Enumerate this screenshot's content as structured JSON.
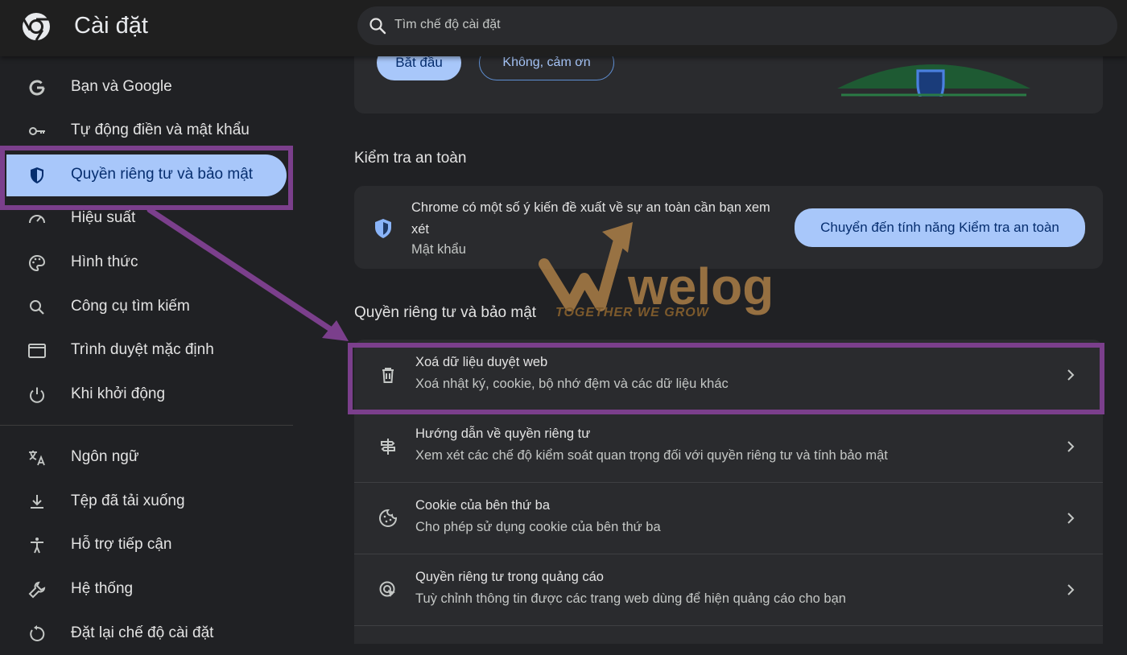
{
  "app": {
    "title": "Cài đặt"
  },
  "search": {
    "placeholder": "Tìm chế độ cài đặt"
  },
  "sidebar": {
    "items": [
      {
        "label": "Bạn và Google",
        "icon": "google-g-icon"
      },
      {
        "label": "Tự động điền và mật khẩu",
        "icon": "key-icon"
      },
      {
        "label": "Quyền riêng tư và bảo mật",
        "icon": "shield-icon",
        "active": true
      },
      {
        "label": "Hiệu suất",
        "icon": "speedometer-icon"
      },
      {
        "label": "Hình thức",
        "icon": "palette-icon"
      },
      {
        "label": "Công cụ tìm kiếm",
        "icon": "search-icon"
      },
      {
        "label": "Trình duyệt mặc định",
        "icon": "browser-window-icon"
      },
      {
        "label": "Khi khởi động",
        "icon": "power-icon"
      },
      {
        "label": "Ngôn ngữ",
        "icon": "translate-icon"
      },
      {
        "label": "Tệp đã tải xuống",
        "icon": "download-icon"
      },
      {
        "label": "Hỗ trợ tiếp cận",
        "icon": "accessibility-icon"
      },
      {
        "label": "Hệ thống",
        "icon": "wrench-icon"
      },
      {
        "label": "Đặt lại chế độ cài đặt",
        "icon": "reset-icon"
      }
    ]
  },
  "promo": {
    "start_label": "Bắt đầu",
    "decline_label": "Không, cảm ơn"
  },
  "safety_check": {
    "heading": "Kiểm tra an toàn",
    "message": "Chrome có một số ý kiến đề xuất về sự an toàn cần bạn xem xét",
    "detail": "Mật khẩu",
    "button_label": "Chuyển đến tính năng Kiểm tra an toàn"
  },
  "privacy": {
    "heading": "Quyền riêng tư và bảo mật",
    "rows": [
      {
        "title": "Xoá dữ liệu duyệt web",
        "subtitle": "Xoá nhật ký, cookie, bộ nhớ đệm và các dữ liệu khác",
        "icon": "trash-icon"
      },
      {
        "title": "Hướng dẫn về quyền riêng tư",
        "subtitle": "Xem xét các chế độ kiểm soát quan trọng đối với quyền riêng tư và tính bảo mật",
        "icon": "signpost-icon"
      },
      {
        "title": "Cookie của bên thứ ba",
        "subtitle": "Cho phép sử dụng cookie của bên thứ ba",
        "icon": "cookie-icon"
      },
      {
        "title": "Quyền riêng tư trong quảng cáo",
        "subtitle": "Tuỳ chỉnh thông tin được các trang web dùng để hiện quảng cáo cho bạn",
        "icon": "ad-privacy-icon"
      }
    ]
  },
  "watermark": {
    "brand": "welog",
    "tagline": "TOGETHER WE GROW"
  },
  "colors": {
    "accent": "#a8c7fa",
    "background": "#202124",
    "card": "#2a2b2e",
    "highlight": "#7b3f8c",
    "watermark": "#b8874a"
  }
}
